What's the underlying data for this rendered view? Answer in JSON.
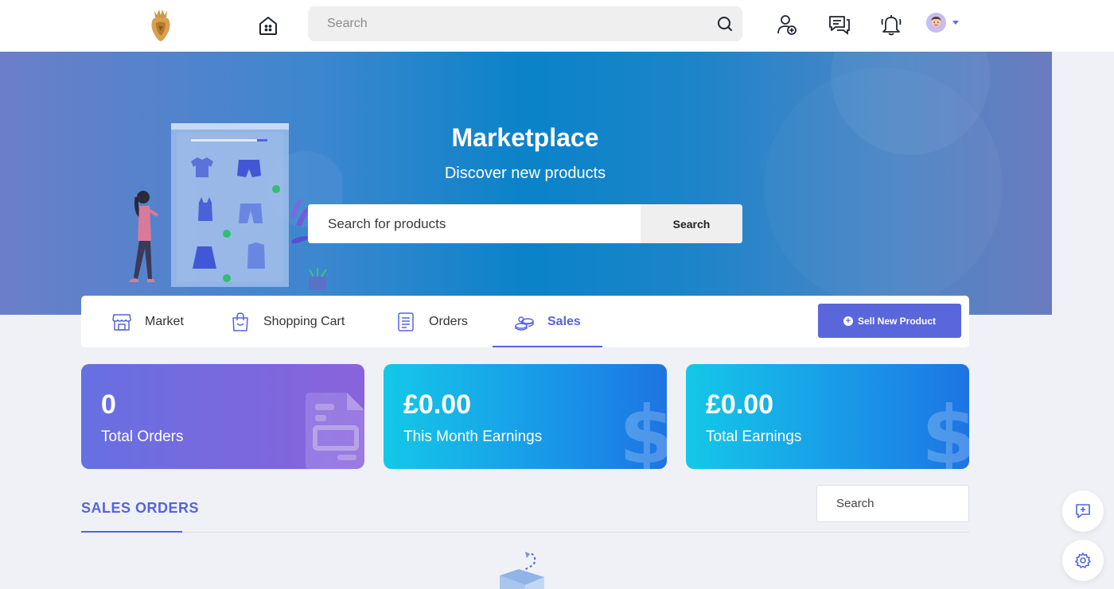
{
  "topnav": {
    "search_placeholder": "Search"
  },
  "hero": {
    "title": "Marketplace",
    "subtitle": "Discover new products",
    "search_placeholder": "Search for products",
    "search_button": "Search"
  },
  "tabs": [
    {
      "label": "Market",
      "icon": "store-icon"
    },
    {
      "label": "Shopping Cart",
      "icon": "shopping-bag-icon"
    },
    {
      "label": "Orders",
      "icon": "document-list-icon"
    },
    {
      "label": "Sales",
      "icon": "coins-icon",
      "active": true
    }
  ],
  "sell_button": "Sell New Product",
  "stats": [
    {
      "value": "0",
      "label": "Total Orders"
    },
    {
      "value": "£0.00",
      "label": "This Month Earnings"
    },
    {
      "value": "£0.00",
      "label": "Total Earnings"
    }
  ],
  "sales_orders": {
    "title": "SALES ORDERS",
    "search_placeholder": "Search"
  },
  "colors": {
    "accent": "#5563de",
    "sell_button": "#5a66db"
  }
}
